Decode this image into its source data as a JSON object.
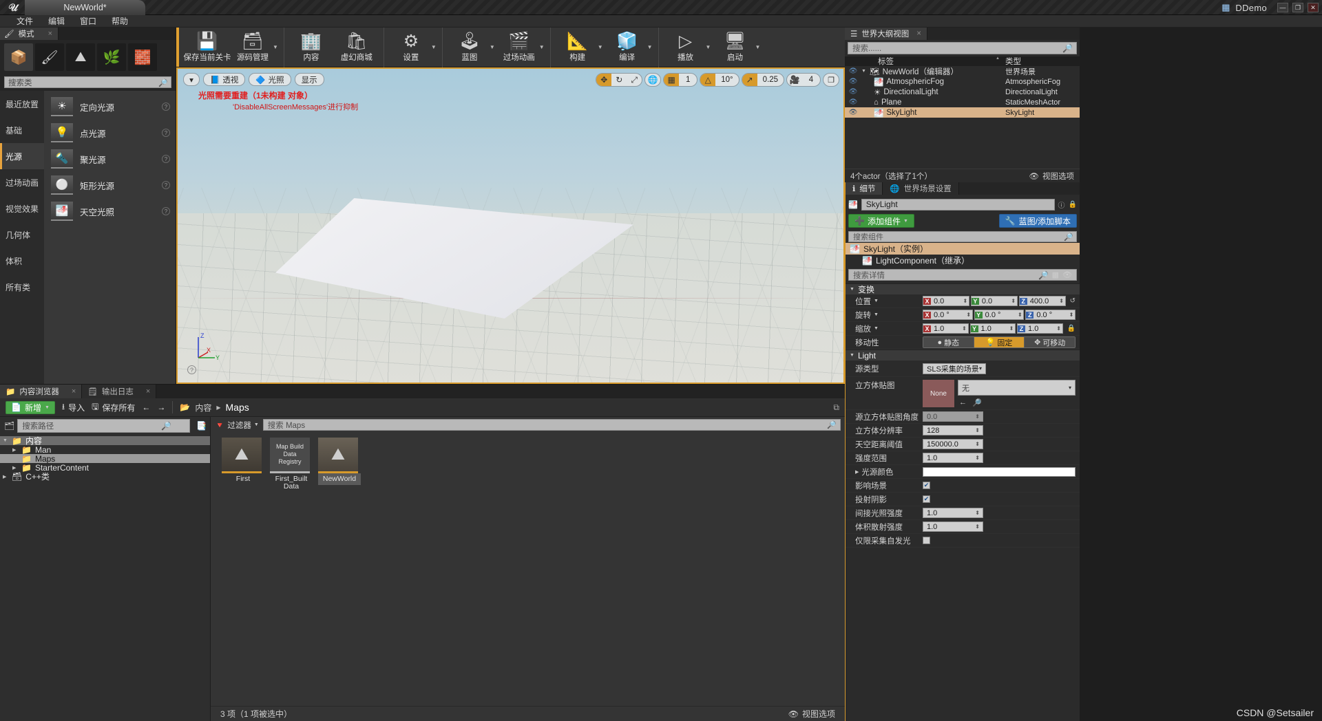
{
  "titlebar": {
    "project": "NewWorld*",
    "app": "DDemo",
    "minimize": "—",
    "maximize": "❐",
    "close": "✕"
  },
  "menubar": {
    "items": [
      "文件",
      "编辑",
      "窗口",
      "帮助"
    ]
  },
  "modes": {
    "tab_label": "模式",
    "tab_close": "×",
    "icons": [
      "place-mode-icon",
      "paint-mode-icon",
      "landscape-mode-icon",
      "foliage-mode-icon",
      "geometry-mode-icon"
    ],
    "search_placeholder": "搜索类",
    "categories": [
      "最近放置",
      "基础",
      "光源",
      "过场动画",
      "视觉效果",
      "几何体",
      "体积",
      "所有类"
    ],
    "selected_category": "光源",
    "items": [
      {
        "label": "定向光源"
      },
      {
        "label": "点光源"
      },
      {
        "label": "聚光源"
      },
      {
        "label": "矩形光源"
      },
      {
        "label": "天空光照"
      }
    ]
  },
  "toolbar": {
    "groups": [
      {
        "items": [
          {
            "label": "保存当前关卡",
            "icon": "save-icon",
            "caret": false
          },
          {
            "label": "源码管理",
            "icon": "source-control-icon",
            "caret": true
          }
        ]
      },
      {
        "items": [
          {
            "label": "内容",
            "icon": "content-icon",
            "caret": false
          },
          {
            "label": "虚幻商城",
            "icon": "marketplace-icon",
            "caret": false
          }
        ]
      },
      {
        "items": [
          {
            "label": "设置",
            "icon": "settings-gear-icon",
            "caret": true
          }
        ]
      },
      {
        "items": [
          {
            "label": "蓝图",
            "icon": "blueprint-icon",
            "caret": true
          },
          {
            "label": "过场动画",
            "icon": "cinematics-icon",
            "caret": true
          }
        ]
      },
      {
        "items": [
          {
            "label": "构建",
            "icon": "build-icon",
            "caret": true
          },
          {
            "label": "编译",
            "icon": "compile-icon",
            "caret": true
          }
        ]
      },
      {
        "items": [
          {
            "label": "播放",
            "icon": "play-icon",
            "caret": true
          },
          {
            "label": "启动",
            "icon": "launch-icon",
            "caret": true
          }
        ]
      }
    ]
  },
  "viewport": {
    "menu_caret": "▾",
    "perspective": "透视",
    "lighting": "光照",
    "show": "显示",
    "warning_line1": "光照需要重建（1未构建 对象）",
    "warning_line2": "'DisableAllScreenMessages'进行抑制",
    "grid_snap_value": "1",
    "rotation_snap_value": "10°",
    "scale_snap_value": "0.25",
    "camera_speed_value": "4",
    "axis_x": "X",
    "axis_y": "Y",
    "axis_z": "Z"
  },
  "outliner": {
    "tab_label": "世界大纲视图",
    "tab_close": "×",
    "search_placeholder": "搜索......",
    "col_label": "标签",
    "col_type": "类型",
    "rows": [
      {
        "name": "NewWorld（编辑器）",
        "type": "世界场景",
        "icon": "world-icon",
        "selected": false,
        "indent": 0
      },
      {
        "name": "AtmosphericFog",
        "type": "AtmosphericFog",
        "icon": "fog-icon",
        "selected": false,
        "indent": 1
      },
      {
        "name": "DirectionalLight",
        "type": "DirectionalLight",
        "icon": "directional-light-icon",
        "selected": false,
        "indent": 1
      },
      {
        "name": "Plane",
        "type": "StaticMeshActor",
        "icon": "mesh-icon",
        "selected": false,
        "indent": 1
      },
      {
        "name": "SkyLight",
        "type": "SkyLight",
        "icon": "skylight-icon",
        "selected": true,
        "indent": 1
      }
    ],
    "footer_count": "4个actor（选择了1个）",
    "footer_viewopts": "视图选项"
  },
  "details": {
    "tab_details": "细节",
    "tab_world_settings": "世界场景设置",
    "actor_name": "SkyLight",
    "add_component": "添加组件",
    "blueprint_script": "蓝图/添加脚本",
    "component_search_placeholder": "搜索组件",
    "components": [
      {
        "label": "SkyLight（实例）",
        "selected": true,
        "child": false
      },
      {
        "label": "LightComponent（继承）",
        "selected": false,
        "child": true
      }
    ],
    "details_search_placeholder": "搜索详情",
    "transform": {
      "section": "变换",
      "location_label": "位置",
      "location": {
        "x": "0.0",
        "y": "0.0",
        "z": "400.0"
      },
      "rotation_label": "旋转",
      "rotation": {
        "x": "0.0 °",
        "y": "0.0 °",
        "z": "0.0 °"
      },
      "scale_label": "缩放",
      "scale": {
        "x": "1.0",
        "y": "1.0",
        "z": "1.0"
      },
      "mobility_label": "移动性",
      "mobility_options": [
        "静态",
        "固定",
        "可移动"
      ],
      "mobility_selected": "固定"
    },
    "light": {
      "section": "Light",
      "rows": [
        {
          "label": "源类型",
          "type": "select",
          "value": "SLS采集的场景"
        },
        {
          "label": "立方体贴图",
          "type": "cubemap",
          "thumb": "None",
          "value": "无"
        },
        {
          "label": "源立方体贴图角度",
          "type": "text",
          "value": "0.0",
          "dim": true
        },
        {
          "label": "立方体分辨率",
          "type": "text",
          "value": "128"
        },
        {
          "label": "天空距离阈值",
          "type": "text",
          "value": "150000.0"
        },
        {
          "label": "强度范围",
          "type": "text",
          "value": "1.0"
        },
        {
          "label": "光源颜色",
          "type": "color",
          "value": "#ffffff"
        },
        {
          "label": "影响场景",
          "type": "check",
          "checked": true
        },
        {
          "label": "投射阴影",
          "type": "check",
          "checked": true
        },
        {
          "label": "间接光照强度",
          "type": "text",
          "value": "1.0"
        },
        {
          "label": "体积散射强度",
          "type": "text",
          "value": "1.0"
        },
        {
          "label": "仅限采集自发光",
          "type": "check",
          "checked": false
        }
      ]
    }
  },
  "content_browser": {
    "tabs": [
      {
        "label": "内容浏览器",
        "icon": "content-browser-icon",
        "active": true,
        "close": "×"
      },
      {
        "label": "输出日志",
        "icon": "output-log-icon",
        "active": false,
        "close": "×"
      }
    ],
    "add_label": "新增",
    "import_label": "导入",
    "save_all_label": "保存所有",
    "back_arrow": "←",
    "forward_arrow": "→",
    "breadcrumb_root": "内容",
    "breadcrumb_sep": "▶",
    "breadcrumb_current": "Maps",
    "path_search_placeholder": "搜索路径",
    "tree": [
      {
        "label": "内容",
        "depth": 0,
        "expanded": true,
        "selected": false,
        "root": true
      },
      {
        "label": "Man",
        "depth": 1,
        "expanded": false,
        "selected": false,
        "root": false
      },
      {
        "label": "Maps",
        "depth": 1,
        "expanded": false,
        "selected": true,
        "root": false
      },
      {
        "label": "StarterContent",
        "depth": 1,
        "expanded": false,
        "selected": false,
        "root": false
      },
      {
        "label": "C++类",
        "depth": 0,
        "expanded": false,
        "selected": false,
        "root": false
      }
    ],
    "filter_label": "过滤器",
    "asset_search_placeholder": "搜索 Maps",
    "assets": [
      {
        "name": "First",
        "thumb_kind": "map",
        "selected": false
      },
      {
        "name": "First_Built Data",
        "thumb_kind": "registry",
        "thumb_text": "Map Build Data Registry",
        "selected": false
      },
      {
        "name": "NewWorld",
        "thumb_kind": "map",
        "selected": true
      }
    ],
    "status": "3 项（1 项被选中）",
    "view_options": "视图选项"
  },
  "watermark": "CSDN @Setsailer"
}
